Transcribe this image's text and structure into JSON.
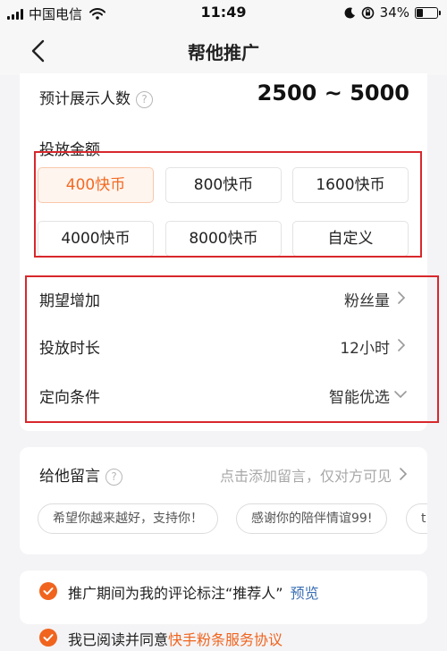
{
  "status_bar": {
    "carrier": "中国电信",
    "time": "11:49",
    "battery": "34%",
    "battery_level": 0.34
  },
  "nav": {
    "title": "帮他推广"
  },
  "reach": {
    "label": "预计展示人数",
    "help_glyph": "?",
    "value": "2500 ~ 5000"
  },
  "amount": {
    "label": "投放金额",
    "options": [
      "400快币",
      "800快币",
      "1600快币",
      "4000快币",
      "8000快币",
      "自定义"
    ],
    "selected": 0
  },
  "settings": [
    {
      "label": "期望增加",
      "value": "粉丝量"
    },
    {
      "label": "投放时长",
      "value": "12小时"
    },
    {
      "label": "定向条件",
      "value": "智能优选"
    }
  ],
  "message": {
    "label": "给他留言",
    "help_glyph": "?",
    "placeholder": "点击添加留言，仅对方可见",
    "chips": [
      "希望你越来越好，支持你！",
      "感谢你的陪伴情谊99!",
      "t"
    ]
  },
  "agreements": {
    "item1_text": "推广期间为我的评论标注“推荐人”",
    "item1_link": "预览",
    "item2_text": "我已阅读并同意",
    "item2_link": "快手粉条服务协议"
  },
  "colors": {
    "accent": "#f26a22",
    "highlight": "#d8282c",
    "link": "#3a6fb5"
  }
}
